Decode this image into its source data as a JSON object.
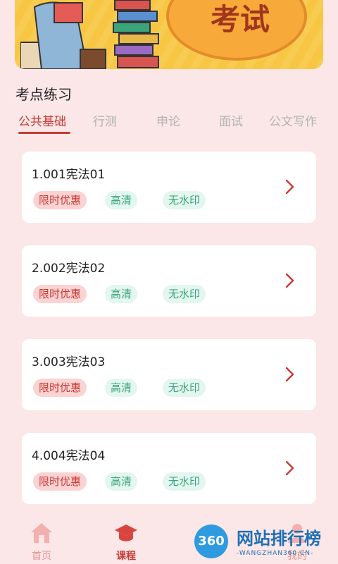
{
  "banner": {
    "speech_text": "考试"
  },
  "section": {
    "title": "考点练习"
  },
  "tabs": [
    {
      "label": "公共基础",
      "active": true
    },
    {
      "label": "行测",
      "active": false
    },
    {
      "label": "申论",
      "active": false
    },
    {
      "label": "面试",
      "active": false
    },
    {
      "label": "公文写作",
      "active": false
    }
  ],
  "cards": [
    {
      "title": "1.001宪法01",
      "tags": [
        "限时优惠",
        "高清",
        "无水印"
      ]
    },
    {
      "title": "2.002宪法02",
      "tags": [
        "限时优惠",
        "高清",
        "无水印"
      ]
    },
    {
      "title": "3.003宪法03",
      "tags": [
        "限时优惠",
        "高清",
        "无水印"
      ]
    },
    {
      "title": "4.004宪法04",
      "tags": [
        "限时优惠",
        "高清",
        "无水印"
      ]
    }
  ],
  "nav": {
    "items": [
      {
        "label": "首页",
        "icon": "home-icon",
        "active": false
      },
      {
        "label": "课程",
        "icon": "graduation-cap-icon",
        "active": true
      },
      {
        "label": "我的",
        "icon": "user-icon",
        "active": false
      }
    ]
  },
  "watermark": {
    "logo_text": "360",
    "title": "网站排行榜",
    "subtitle": "-WANGZHAN360.CN-"
  },
  "colors": {
    "accent": "#c83a34",
    "background": "#fbe7e7",
    "tag_green": "#3aa57a",
    "tag_red_bg": "#fbd3d3"
  }
}
